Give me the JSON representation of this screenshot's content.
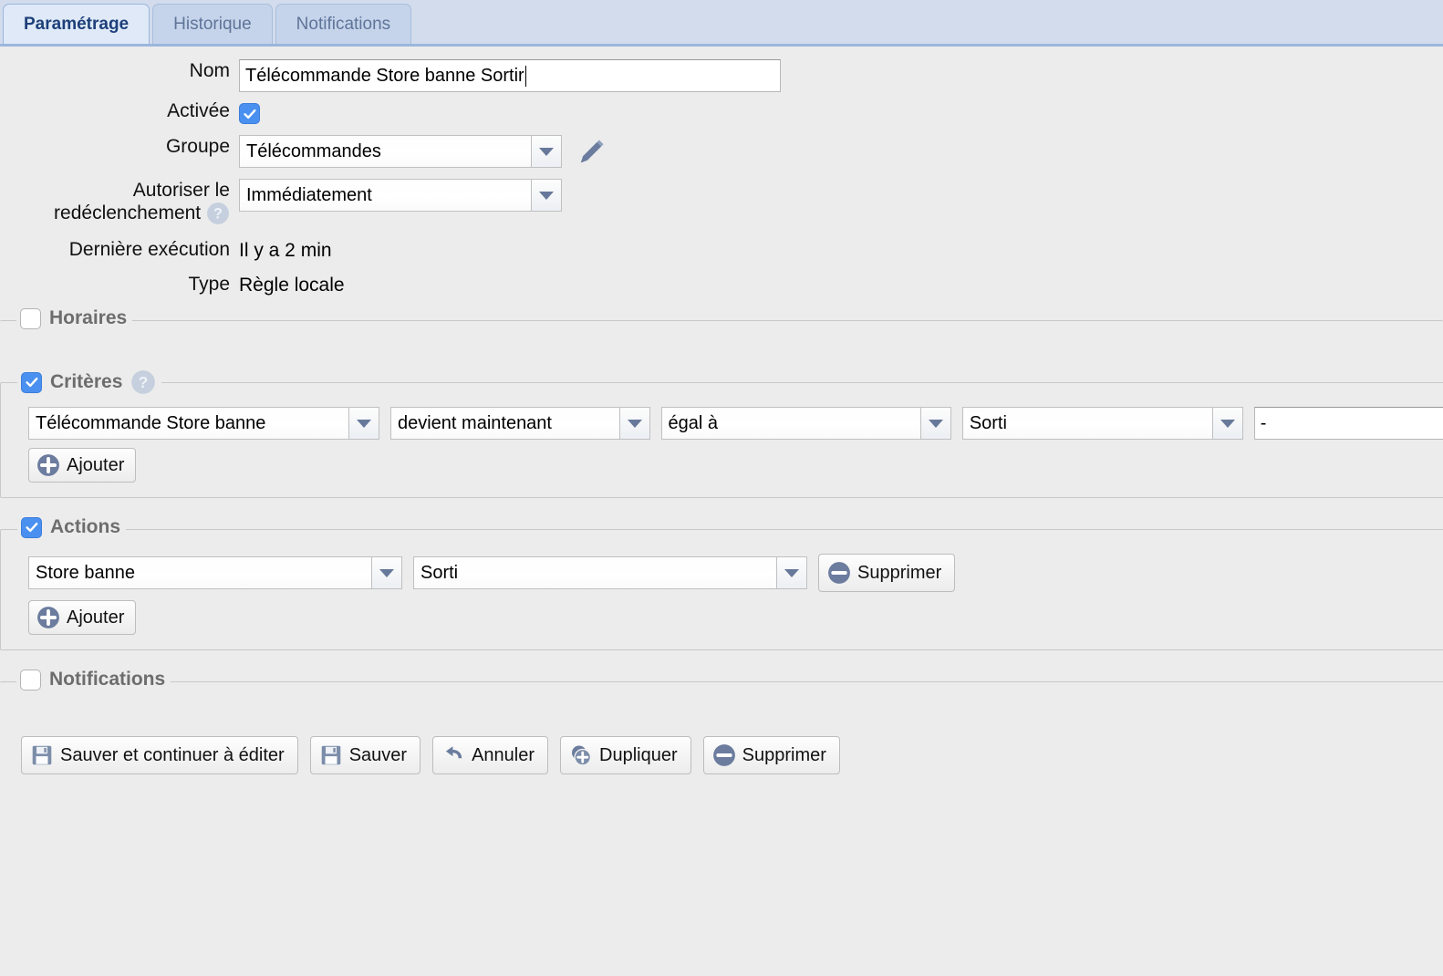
{
  "tabs": [
    {
      "label": "Paramétrage",
      "active": true
    },
    {
      "label": "Historique",
      "active": false
    },
    {
      "label": "Notifications",
      "active": false
    }
  ],
  "form": {
    "nom_label": "Nom",
    "nom_value": "Télécommande Store banne Sortir",
    "activee_label": "Activée",
    "activee_checked": true,
    "groupe_label": "Groupe",
    "groupe_value": "Télécommandes",
    "autoriser_label_line1": "Autoriser le",
    "autoriser_label_line2": "redéclenchement",
    "autoriser_value": "Immédiatement",
    "derniere_execution_label": "Dernière exécution",
    "derniere_execution_value": "Il y a 2 min",
    "type_label": "Type",
    "type_value": "Règle locale"
  },
  "sections": {
    "horaires": {
      "legend": "Horaires",
      "checked": false
    },
    "criteres": {
      "legend": "Critères",
      "checked": true,
      "rows": [
        {
          "device": "Télécommande Store banne",
          "event": "devient maintenant",
          "operator": "égal à",
          "value": "Sorti",
          "extra": "-"
        }
      ],
      "add_label": "Ajouter"
    },
    "actions": {
      "legend": "Actions",
      "checked": true,
      "rows": [
        {
          "device": "Store banne",
          "state": "Sorti",
          "delete_label": "Supprimer"
        }
      ],
      "add_label": "Ajouter"
    },
    "notifications": {
      "legend": "Notifications",
      "checked": false
    }
  },
  "footer": {
    "save_continue_label": "Sauver et continuer à éditer",
    "save_label": "Sauver",
    "cancel_label": "Annuler",
    "duplicate_label": "Dupliquer",
    "delete_label": "Supprimer"
  },
  "colors": {
    "accent_blue": "#4a90f0",
    "tab_active_text": "#1d3f7a",
    "tabbar_bg": "#d2dcec",
    "icon_blue_grey": "#6b7c9e",
    "page_bg": "#ececec"
  }
}
